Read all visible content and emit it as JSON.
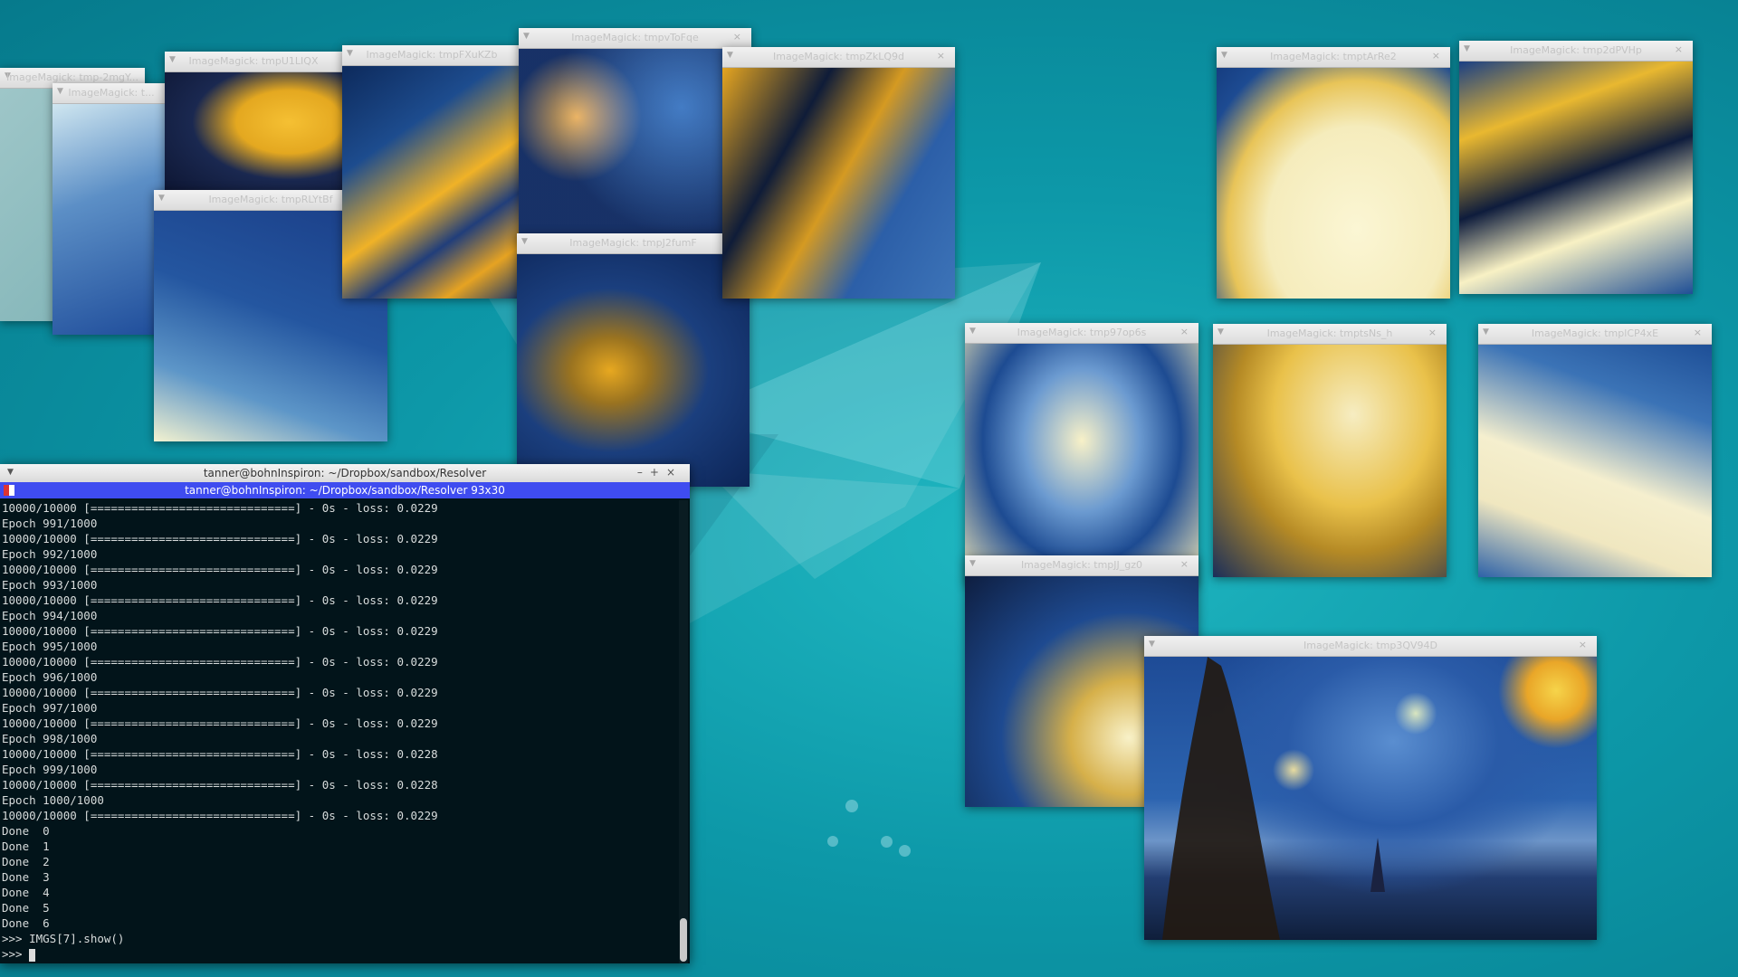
{
  "desktop": {
    "background_color": "#0d98a8"
  },
  "image_windows": [
    {
      "title": "ImageMagick: tmp-2mgY..."
    },
    {
      "title": "ImageMagick: t..."
    },
    {
      "title": "ImageMagick: tmpU1LIQX"
    },
    {
      "title": "ImageMagick: tmpRLYtBf"
    },
    {
      "title": "ImageMagick: tmpFXuKZb"
    },
    {
      "title": "ImageMagick: tmpvToFqe"
    },
    {
      "title": "ImageMagick: tmpJ2fumF"
    },
    {
      "title": "ImageMagick: tmpZkLQ9d"
    },
    {
      "title": "ImageMagick: tmptArRe2"
    },
    {
      "title": "ImageMagick: tmp2dPVHp"
    },
    {
      "title": "ImageMagick: tmp97op6s"
    },
    {
      "title": "ImageMagick: tmptsNs_h"
    },
    {
      "title": "ImageMagick: tmplCP4xE"
    },
    {
      "title": "ImageMagick: tmpJJ_gz0"
    },
    {
      "title": "ImageMagick: tmp3QV94D"
    }
  ],
  "window_controls": {
    "minimize": "–",
    "maximize": "+",
    "close": "×",
    "menu": "▼"
  },
  "terminal": {
    "title": "tanner@bohnInspiron: ~/Dropbox/sandbox/Resolver",
    "xterm_title": "tanner@bohnInspiron: ~/Dropbox/sandbox/Resolver 93x30",
    "lines": [
      "10000/10000 [==============================] - 0s - loss: 0.0229",
      "Epoch 991/1000",
      "10000/10000 [==============================] - 0s - loss: 0.0229",
      "Epoch 992/1000",
      "10000/10000 [==============================] - 0s - loss: 0.0229",
      "Epoch 993/1000",
      "10000/10000 [==============================] - 0s - loss: 0.0229",
      "Epoch 994/1000",
      "10000/10000 [==============================] - 0s - loss: 0.0229",
      "Epoch 995/1000",
      "10000/10000 [==============================] - 0s - loss: 0.0229",
      "Epoch 996/1000",
      "10000/10000 [==============================] - 0s - loss: 0.0229",
      "Epoch 997/1000",
      "10000/10000 [==============================] - 0s - loss: 0.0229",
      "Epoch 998/1000",
      "10000/10000 [==============================] - 0s - loss: 0.0228",
      "Epoch 999/1000",
      "10000/10000 [==============================] - 0s - loss: 0.0228",
      "Epoch 1000/1000",
      "10000/10000 [==============================] - 0s - loss: 0.0229",
      "Done  0",
      "Done  1",
      "Done  2",
      "Done  3",
      "Done  4",
      "Done  5",
      "Done  6",
      ">>> IMGS[7].show()"
    ],
    "prompt": ">>> "
  }
}
